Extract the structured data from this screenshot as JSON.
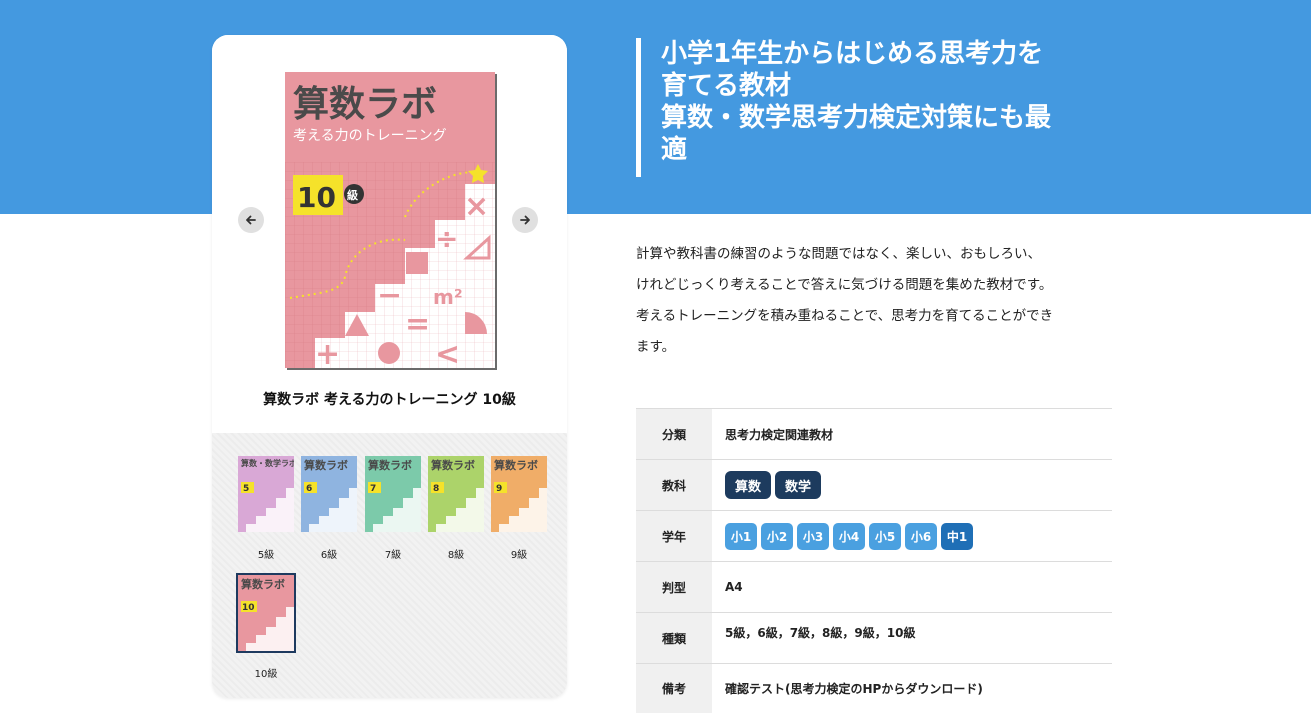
{
  "hero": {
    "heading": "小学1年生からはじめる思考力を育てる教材\n算数・数学思考力検定対策にも最適",
    "heading_lines": [
      "小学1年生からはじめる思考力を",
      "育てる教材",
      "算数・数学思考力検定対策にも最",
      "適"
    ],
    "color": "#4499e0"
  },
  "product": {
    "cover": {
      "title": "算数ラボ",
      "subtitle": "考える力のトレーニング",
      "level_number": "10",
      "level_suffix": "級",
      "math_symbols": [
        "×",
        "÷",
        "−",
        "m²",
        "=",
        "+",
        "<"
      ],
      "color": "#e8979f"
    },
    "title": "算数ラボ 考える力のトレーニング 10級",
    "prev_icon": "arrow-left-icon",
    "next_icon": "arrow-right-icon"
  },
  "thumbnails": [
    {
      "label": "5級",
      "title": "算数・数学ラボ",
      "number": "5",
      "color": "#d9a8d6",
      "selected": false
    },
    {
      "label": "6級",
      "title": "算数ラボ",
      "number": "6",
      "color": "#8fb4e0",
      "selected": false
    },
    {
      "label": "7級",
      "title": "算数ラボ",
      "number": "7",
      "color": "#7ccaaa",
      "selected": false
    },
    {
      "label": "8級",
      "title": "算数ラボ",
      "number": "8",
      "color": "#acd36a",
      "selected": false
    },
    {
      "label": "9級",
      "title": "算数ラボ",
      "number": "9",
      "color": "#f0ad68",
      "selected": false
    },
    {
      "label": "10級",
      "title": "算数ラボ",
      "number": "10",
      "color": "#e8979f",
      "selected": true
    }
  ],
  "description": [
    "計算や教科書の練習のような問題ではなく、楽しい、おもしろい、",
    "けれどじっくり考えることで答えに気づける問題を集めた教材です。",
    "考えるトレーニングを積み重ねることで、思考力を育てることができ",
    "ます。"
  ],
  "spec": {
    "category": {
      "key": "分類",
      "value": "思考力検定関連教材"
    },
    "subject": {
      "key": "教科",
      "tags": [
        "算数",
        "数学"
      ]
    },
    "grade": {
      "key": "学年",
      "tags": [
        "小1",
        "小2",
        "小3",
        "小4",
        "小5",
        "小6",
        "中1"
      ]
    },
    "size": {
      "key": "判型",
      "value": "A4"
    },
    "types": {
      "key": "種類",
      "value": "5級，6級，7級，8級，9級，10級"
    },
    "notes": {
      "key": "備考",
      "value": "確認テスト(思考力検定のHPからダウンロード)"
    }
  },
  "colors": {
    "subject_tag": "#1d3b5e",
    "grade_tag": "#4aa0e0",
    "grade_tag_dark": "#1f6fb6"
  }
}
